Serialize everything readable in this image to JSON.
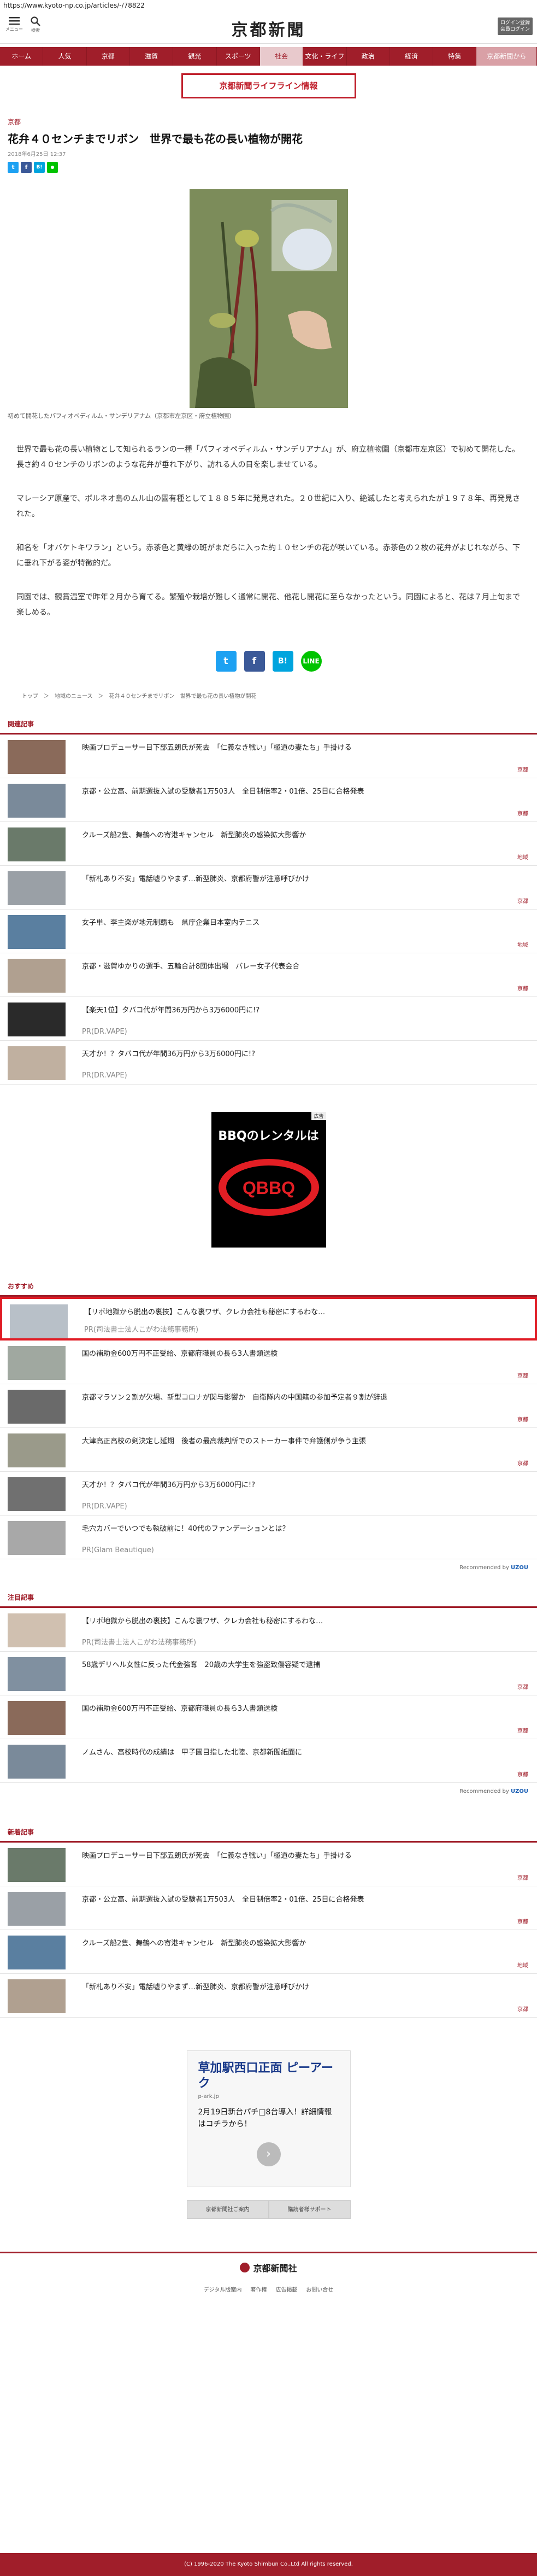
{
  "browser": {
    "url": "https://www.kyoto-np.co.jp/articles/-/78822"
  },
  "header": {
    "menu_label": "メニュー",
    "search_label": "検索",
    "logo": "京都新聞",
    "login": "ログイン登録\n会員ログイン"
  },
  "nav": [
    "ホーム",
    "人気",
    "京都",
    "滋賀",
    "観光",
    "スポーツ",
    "社会",
    "文化・ライフ",
    "政治",
    "経済",
    "特集",
    "京都新聞から"
  ],
  "banner": "京都新聞ライフライン情報",
  "article": {
    "category": "京都",
    "title": "花弁４０センチまでリボン　世界で最も花の長い植物が開花",
    "date": "2018年6月25日 12:37",
    "caption": "初めて開花したパフィオペディルム・サンデリアナム（京都市左京区・府立植物園）",
    "paragraphs": [
      "世界で最も花の長い植物として知られるランの一種「パフィオペディルム・サンデリアナム」が、府立植物園（京都市左京区）で初めて開花した。長さ約４０センチのリボンのような花弁が垂れ下がり、訪れる人の目を楽しませている。",
      "マレーシア原産で、ボルネオ島のムル山の固有種として１８８５年に発見された。２０世紀に入り、絶滅したと考えられたが１９７８年、再発見された。",
      "和名を「オバケトキワラン」という。赤茶色と黄緑の斑がまだらに入った約１０センチの花が咲いている。赤茶色の２枚の花弁がよじれながら、下に垂れ下がる姿が特徴的だ。",
      "同園では、観賞温室で昨年２月から育てる。繁殖や栽培が難しく通常に開花、他花し開花に至らなかったという。同園によると、花は７月上旬まで楽しめる。"
    ],
    "breadcrumb": "トップ　＞　地域のニュース　＞　花弁４０センチまでリボン　世界で最も花の長い植物が開花"
  },
  "related": {
    "heading": "関連記事",
    "items": [
      {
        "text": "映画プロデューサー日下部五朗氏が死去　「仁義なき戦い」「極道の妻たち」手掛ける",
        "tag": "京都"
      },
      {
        "text": "京都・公立高、前期選抜入試の受験者1万503人　全日制倍率2・01倍、25日に合格発表",
        "tag": "京都"
      },
      {
        "text": "クルーズ船2隻、舞鶴への寄港キャンセル　新型肺炎の感染拡大影響か",
        "tag": "地域"
      },
      {
        "text": "「新札あり不安」電話嘘りやまず…新型肺炎、京都府警が注意呼びかけ",
        "tag": "京都"
      },
      {
        "text": "女子単、李主楽が地元制覇も　県庁企業日本室内テニス",
        "tag": "地域"
      },
      {
        "text": "京都・滋賀ゆかりの選手、五輪合計8団体出場　バレー女子代表会合",
        "tag": "京都"
      },
      {
        "text": "【楽天1位】タバコ代が年間36万円から3万6000円に!?",
        "tag": "PR(DR.VAPE)"
      },
      {
        "text": "天才か！？タバコ代が年間36万円から3万6000円に!?",
        "tag": "PR(DR.VAPE)"
      }
    ]
  },
  "ad1": {
    "label": "広告",
    "brand": "BBQのレンタルは",
    "logo": "QBBQ"
  },
  "recommend": {
    "heading": "おすすめ",
    "items": [
      {
        "text": "【リボ地獄から脱出の裏技】こんな裏ワザ、クレカ会社も秘密にするわな…",
        "tag": "PR(司法書士法人こがわ法務事務所)"
      },
      {
        "text": "国の補助金600万円不正受給、京都府職員の長ら3人書類送検",
        "tag": "京都"
      },
      {
        "text": "京都マラソン２割が欠場、新型コロナが関与影響か　自衛隊内の中国籍の参加予定者９割が辞退",
        "tag": "京都"
      },
      {
        "text": "大津高正高校の剣決定し延期　後者の最高裁判所でのストーカー事件で弁護側が争う主張",
        "tag": "京都"
      },
      {
        "text": "天才か！？タバコ代が年間36万円から3万6000円に!?",
        "tag": "PR(DR.VAPE)"
      },
      {
        "text": "毛穴カバーでいつでも執破前に！40代のファンデーションとは？",
        "tag": "PR(Glam Beautique)"
      }
    ],
    "recommended_by": "Recommended by"
  },
  "attention": {
    "heading": "注目記事",
    "items": [
      {
        "text": "【リボ地獄から脱出の裏技】こんな裏ワザ、クレカ会社も秘密にするわな…",
        "tag": "PR(司法書士法人こがわ法務事務所)"
      },
      {
        "text": "58歳デリヘル女性に反った代金強奪　20歳の大学生を強盗致傷容疑で逮捕",
        "tag": "京都"
      },
      {
        "text": "国の補助金600万円不正受給、京都府職員の長ら3人書類送検",
        "tag": "京都"
      },
      {
        "text": "ノムさん、高校時代の成績は　甲子園目指した北陸、京都新聞紙面に",
        "tag": "京都"
      }
    ],
    "recommended_by": "Recommended by"
  },
  "latest": {
    "heading": "新着記事",
    "items": [
      {
        "text": "映画プロデューサー日下部五朗氏が死去　「仁義なき戦い」「極道の妻たち」手掛ける",
        "tag": "京都"
      },
      {
        "text": "京都・公立高、前期選抜入試の受験者1万503人　全日制倍率2・01倍、25日に合格発表",
        "tag": "京都"
      },
      {
        "text": "クルーズ船2隻、舞鶴への寄港キャンセル　新型肺炎の感染拡大影響か",
        "tag": "地域"
      },
      {
        "text": "「新札あり不安」電話嘘りやまず…新型肺炎、京都府警が注意呼びかけ",
        "tag": "京都"
      }
    ]
  },
  "ad2": {
    "title": "草加駅西口正面 ピーアーク",
    "url": "p-ark.jp",
    "body": "2月19日新台パチ□8台導入！詳細情報はコチラから！"
  },
  "footer_buttons": [
    "京都新聞社ご案内",
    "購読者様サポート"
  ],
  "footer": {
    "logo": "京都新聞社",
    "links": [
      "デジタル版案内",
      "著作権",
      "広告掲載",
      "お問い合せ"
    ],
    "copyright": "(C) 1996-2020 The Kyoto Shimbun Co.,Ltd All rights reserved."
  },
  "colors": {
    "brand": "#a01e2a",
    "highlight": "#e01b24"
  }
}
